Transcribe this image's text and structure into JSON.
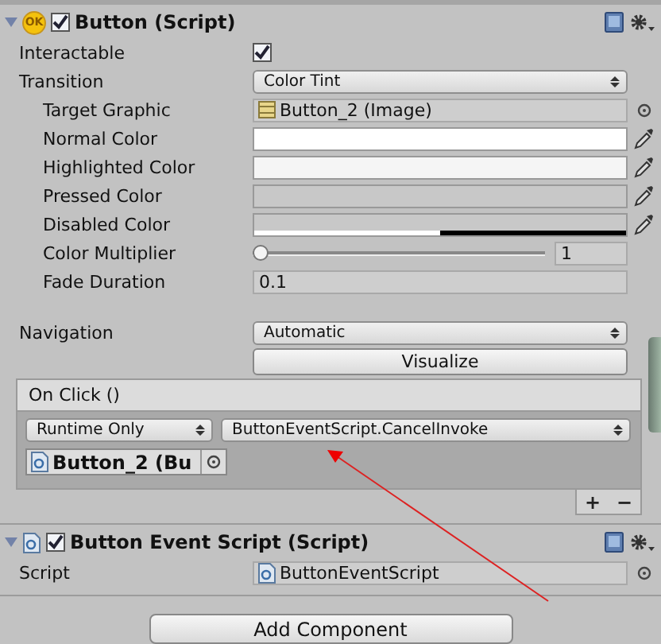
{
  "button_component": {
    "title": "Button (Script)",
    "badge": "OK",
    "expanded": true,
    "enabled": true,
    "fields": [
      {
        "kind": "checkbox",
        "label": "Interactable",
        "checked": true
      },
      {
        "kind": "dropdown",
        "label": "Transition",
        "value": "Color Tint",
        "children": [
          {
            "kind": "object",
            "label": "Target Graphic",
            "value": "Button_2 (Image)"
          },
          {
            "kind": "color",
            "label": "Normal Color",
            "color": "#ffffff"
          },
          {
            "kind": "color",
            "label": "Highlighted Color",
            "color": "#f5f5f5"
          },
          {
            "kind": "color",
            "label": "Pressed Color",
            "color": "#c8c8c8"
          },
          {
            "kind": "color",
            "label": "Disabled Color",
            "color": "#c8c8c8",
            "level": 0.5
          },
          {
            "kind": "slider",
            "label": "Color Multiplier",
            "level": 0,
            "value": "1"
          },
          {
            "kind": "number",
            "label": "Fade Duration",
            "value": "0.1"
          }
        ]
      },
      {
        "kind": "gap"
      },
      {
        "kind": "dropdown",
        "label": "Navigation",
        "value": "Automatic"
      },
      {
        "kind": "button",
        "label": "Visualize"
      }
    ]
  },
  "on_click": {
    "title": "On Click ()",
    "listeners": [
      {
        "mode": "Runtime Only",
        "function": "ButtonEventScript.CancelInvoke",
        "target": "Button_2 (Bu"
      }
    ],
    "add": "+",
    "remove": "−"
  },
  "script_component": {
    "title": "Button Event Script (Script)",
    "expanded": true,
    "enabled": true,
    "fields": [
      {
        "kind": "script",
        "label": "Script",
        "value": "ButtonEventScript"
      }
    ]
  },
  "add_component": "Add Component"
}
